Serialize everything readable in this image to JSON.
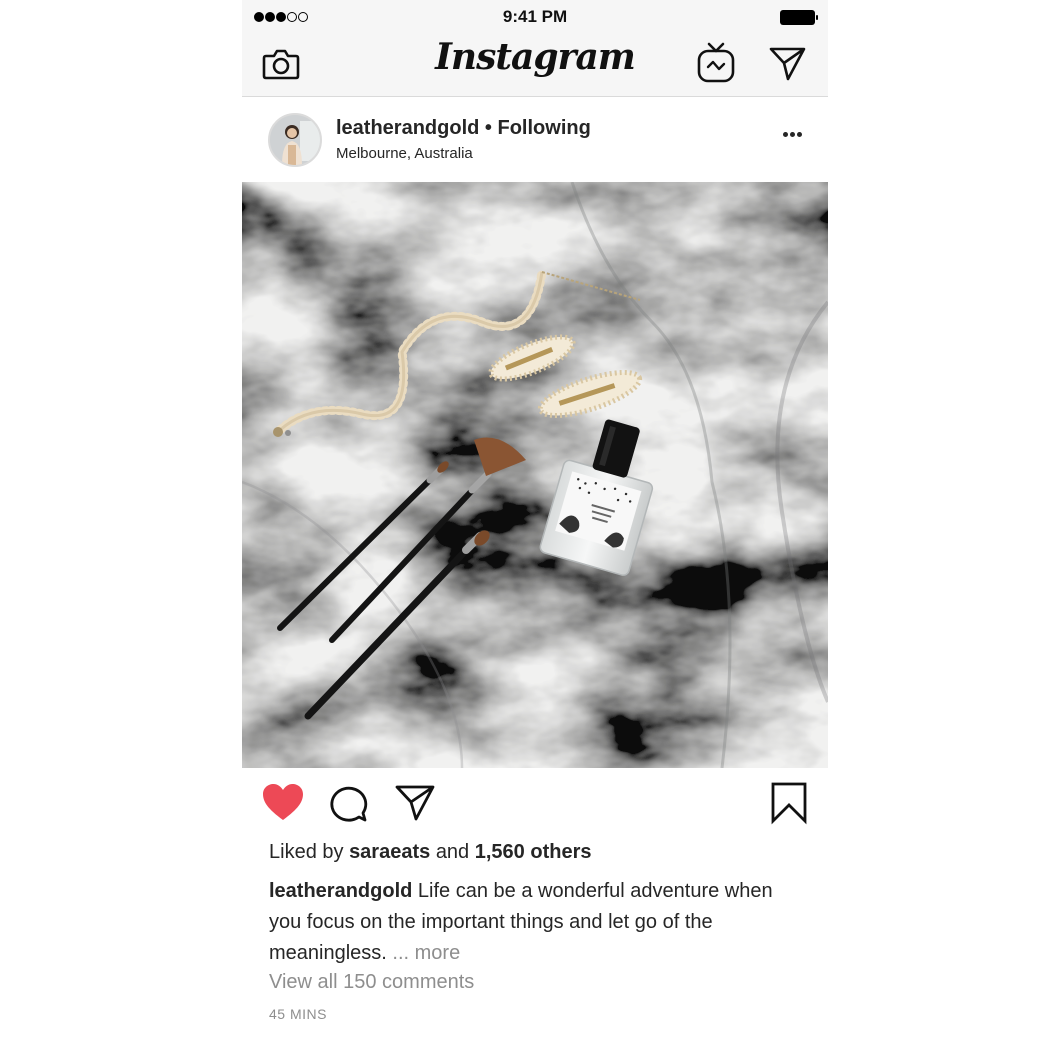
{
  "status_bar": {
    "time": "9:41 PM",
    "signal_dots_filled": 3,
    "signal_dots_total": 5
  },
  "nav": {
    "logo": "Instagram",
    "icons": [
      "camera-icon",
      "igtv-icon",
      "direct-message-icon"
    ]
  },
  "post": {
    "username": "leatherandgold",
    "separator": "•",
    "follow_status": "Following",
    "location": "Melbourne, Australia",
    "liked_by_prefix": "Liked by",
    "liked_by_user": "saraeats",
    "liked_by_and": "and",
    "likes_others": "1,560 others",
    "caption_text": "Life can be a wonderful adventure when you focus on the important things and let go of the meaningless.",
    "caption_more": "... more",
    "view_comments": "View all 150 comments",
    "timestamp": "45 MINS",
    "liked": true
  },
  "colors": {
    "heart": "#ed4956",
    "bar_background": "#f6f6f6",
    "muted_text": "#8e8e8e"
  }
}
